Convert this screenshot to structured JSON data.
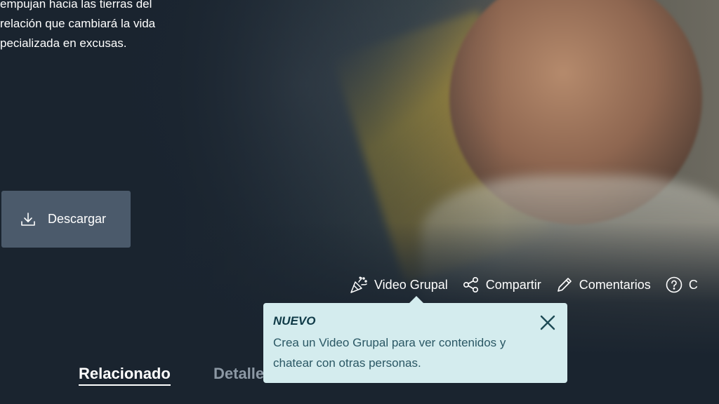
{
  "synopsis": {
    "lines": [
      "empujan hacia las tierras del",
      "relación que cambiará la vida",
      "pecializada en excusas."
    ]
  },
  "download_button": {
    "label": "Descargar",
    "icon": "download-icon"
  },
  "actions": [
    {
      "label": "Video Grupal",
      "icon": "party-popper-icon"
    },
    {
      "label": "Compartir",
      "icon": "share-icon"
    },
    {
      "label": "Comentarios",
      "icon": "pencil-icon"
    },
    {
      "label": "C",
      "icon": "help-circle-icon"
    }
  ],
  "tooltip": {
    "title": "NUEVO",
    "body": "Crea un Video Grupal para ver contenidos y chatear con otras personas.",
    "close_icon": "close-icon"
  },
  "tabs": {
    "related": "Relacionado",
    "details": "Detalles"
  },
  "colors": {
    "background": "#1a242f",
    "button_bg": "#4b5a6b",
    "tooltip_bg": "#d4ecee",
    "tooltip_text": "#1d4a55",
    "inactive_tab": "#8c98a4"
  }
}
